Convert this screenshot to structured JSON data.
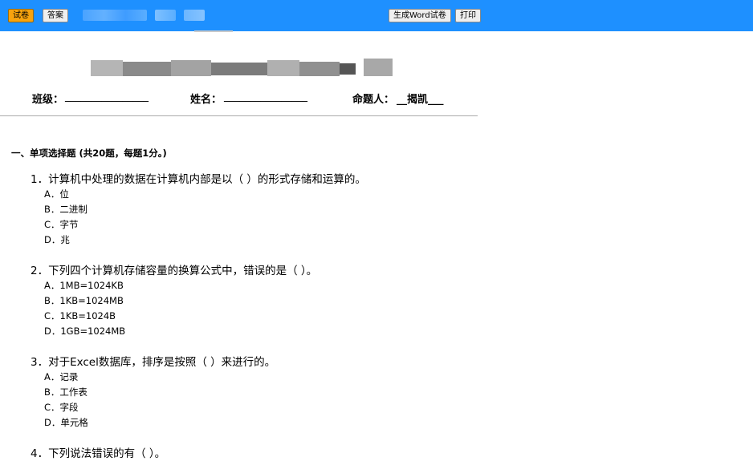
{
  "toolbar": {
    "exam_button": "试卷",
    "answer_button": "答案",
    "word_button": "生成Word试卷",
    "print_button": "打印"
  },
  "header": {
    "class_label": "班级：",
    "class_blank": "________________",
    "name_label": "姓名：",
    "name_blank": "________________",
    "author_label": "命题人：",
    "author_value": "__揭凯___"
  },
  "section": {
    "title": "一、单项选择题 (共20题，每题1分。)"
  },
  "questions": [
    {
      "stem": "1．计算机中处理的数据在计算机内部是以（ ）的形式存储和运算的。",
      "options": [
        "A．位",
        "B．二进制",
        "C．字节",
        "D．兆"
      ]
    },
    {
      "stem": "2．下列四个计算机存储容量的换算公式中，错误的是（ ）。",
      "options": [
        "A．1MB=1024KB",
        "B．1KB=1024MB",
        "C．1KB=1024B",
        "D．1GB=1024MB"
      ]
    },
    {
      "stem": "3．对于Excel数据库，排序是按照（ ）来进行的。",
      "options": [
        "A．记录",
        "B．工作表",
        "C．字段",
        "D．单元格"
      ]
    },
    {
      "stem": "4．下列说法错误的有（ ）。",
      "options": []
    }
  ]
}
